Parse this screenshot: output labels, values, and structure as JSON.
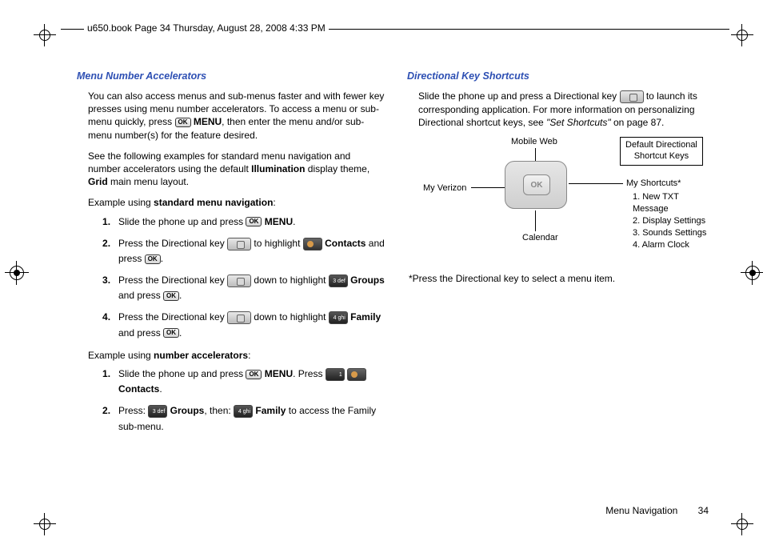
{
  "header": {
    "running_head": "u650.book  Page 34  Thursday, August 28, 2008  4:33 PM"
  },
  "left": {
    "heading": "Menu Number Accelerators",
    "p1a": "You can also access menus and sub-menus faster and with fewer key presses using menu number accelerators. To access a menu or sub-menu quickly, press ",
    "p1b": " MENU",
    "p1c": ", then enter the menu and/or sub-menu number(s) for the feature desired.",
    "p2a": "See the following examples for standard menu navigation and number accelerators using the default ",
    "p2b": "Illumination",
    "p2c": " display theme, ",
    "p2d": "Grid",
    "p2e": " main menu layout.",
    "ex1_intro_a": "Example using ",
    "ex1_intro_b": "standard menu navigation",
    "ex1_intro_c": ":",
    "ex1_s1a": "Slide the phone up and press ",
    "ex1_s1b": " MENU",
    "ex1_s1c": ".",
    "ex1_s2a": "Press the Directional key ",
    "ex1_s2b": " to highlight ",
    "ex1_s2c": " Contacts",
    "ex1_s2d": " and press ",
    "ex1_s2e": ".",
    "ex1_s3a": "Press the Directional key ",
    "ex1_s3b": " down to highlight ",
    "ex1_s3c": " Groups",
    "ex1_s3d": " and press ",
    "ex1_s3e": ".",
    "ex1_s4a": "Press the Directional key ",
    "ex1_s4b": " down to highlight ",
    "ex1_s4c": " Family",
    "ex1_s4d": " and press ",
    "ex1_s4e": ".",
    "ex2_intro_a": "Example using ",
    "ex2_intro_b": "number accelerators",
    "ex2_intro_c": ":",
    "ex2_s1a": "Slide the phone up and press ",
    "ex2_s1b": " MENU",
    "ex2_s1c": ". Press ",
    "ex2_s1d": " Contacts",
    "ex2_s1e": ".",
    "ex2_s2a": "Press: ",
    "ex2_s2b": " Groups",
    "ex2_s2c": ", then: ",
    "ex2_s2d": " Family",
    "ex2_s2e": " to access the Family sub-menu.",
    "key3": "3 def",
    "key4": "4 ghi",
    "key1": "1"
  },
  "right": {
    "heading": "Directional Key Shortcuts",
    "p1a": "Slide the phone up and press a Directional key ",
    "p1b": " to launch its corresponding application. For more information on personalizing Directional shortcut keys, see ",
    "p1c": "\"Set Shortcuts\"",
    "p1d": " on page 87.",
    "sc_up": "Mobile Web",
    "sc_left": "My Verizon",
    "sc_right": "My Shortcuts*",
    "sc_down": "Calendar",
    "sc_box1": "Default Directional",
    "sc_box2": "Shortcut Keys",
    "sc_list1": "1. New TXT Message",
    "sc_list2": "2. Display Settings",
    "sc_list3": "3. Sounds Settings",
    "sc_list4": "4. Alarm Clock",
    "note": "*Press the Directional key to select a menu item.",
    "ok": "OK"
  },
  "footer": {
    "section": "Menu Navigation",
    "page": "34"
  }
}
